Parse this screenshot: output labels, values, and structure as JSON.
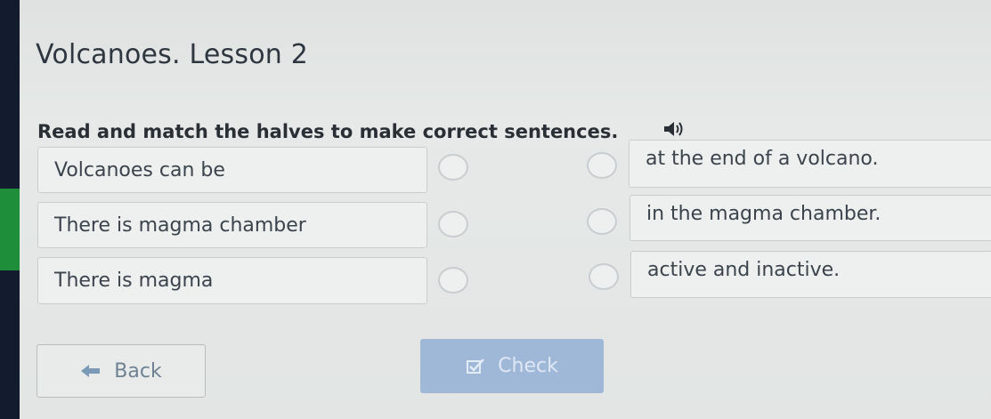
{
  "lesson": {
    "title": "Volcanoes. Lesson 2"
  },
  "task": {
    "instruction": "Read and match the halves to make correct sentences.",
    "speaker_icon": "speaker-icon"
  },
  "left_items": [
    {
      "text": "Volcanoes can be"
    },
    {
      "text": "There is magma chamber"
    },
    {
      "text": "There is magma"
    }
  ],
  "right_items": [
    {
      "text": "at the end of a volcano."
    },
    {
      "text": "in the magma chamber."
    },
    {
      "text": "active and inactive."
    }
  ],
  "buttons": {
    "back_label": "Back",
    "back_icon": "arrow-left-icon",
    "check_label": "Check",
    "check_icon": "checkbox-icon"
  },
  "colors": {
    "check_button": "#9fb8d8",
    "left_accent": "#1f8e3a"
  }
}
